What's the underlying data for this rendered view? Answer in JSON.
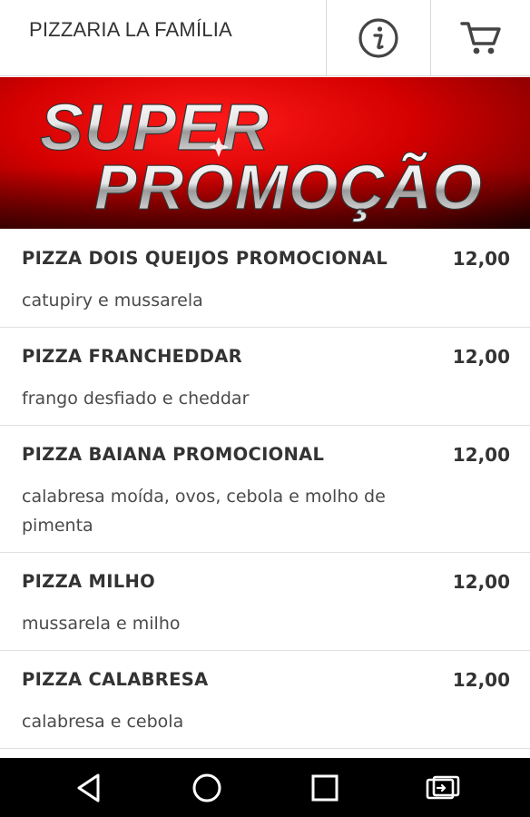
{
  "app": {
    "title": "PIZZARIA LA FAMÍLIA"
  },
  "header": {
    "info_icon": "info-circle-icon",
    "cart_icon": "shopping-cart-icon"
  },
  "banner": {
    "line1": "SUPER",
    "line2": "PROMOÇÃO",
    "background_color": "#d40000"
  },
  "menu": {
    "items": [
      {
        "name": "PIZZA DOIS QUEIJOS PROMOCIONAL",
        "price": "12,00",
        "description": "catupiry e mussarela"
      },
      {
        "name": "PIZZA FRANCHEDDAR",
        "price": "12,00",
        "description": "frango desfiado e cheddar"
      },
      {
        "name": "PIZZA BAIANA PROMOCIONAL",
        "price": "12,00",
        "description": "calabresa moída, ovos, cebola e molho de pimenta"
      },
      {
        "name": "PIZZA MILHO",
        "price": "12,00",
        "description": "mussarela e milho"
      },
      {
        "name": "PIZZA CALABRESA",
        "price": "12,00",
        "description": "calabresa e cebola"
      }
    ]
  },
  "navigation_bar": {
    "back_icon": "back-triangle-icon",
    "home_icon": "home-circle-icon",
    "recents_icon": "recents-square-icon",
    "rotate_icon": "screen-rotate-icon"
  }
}
